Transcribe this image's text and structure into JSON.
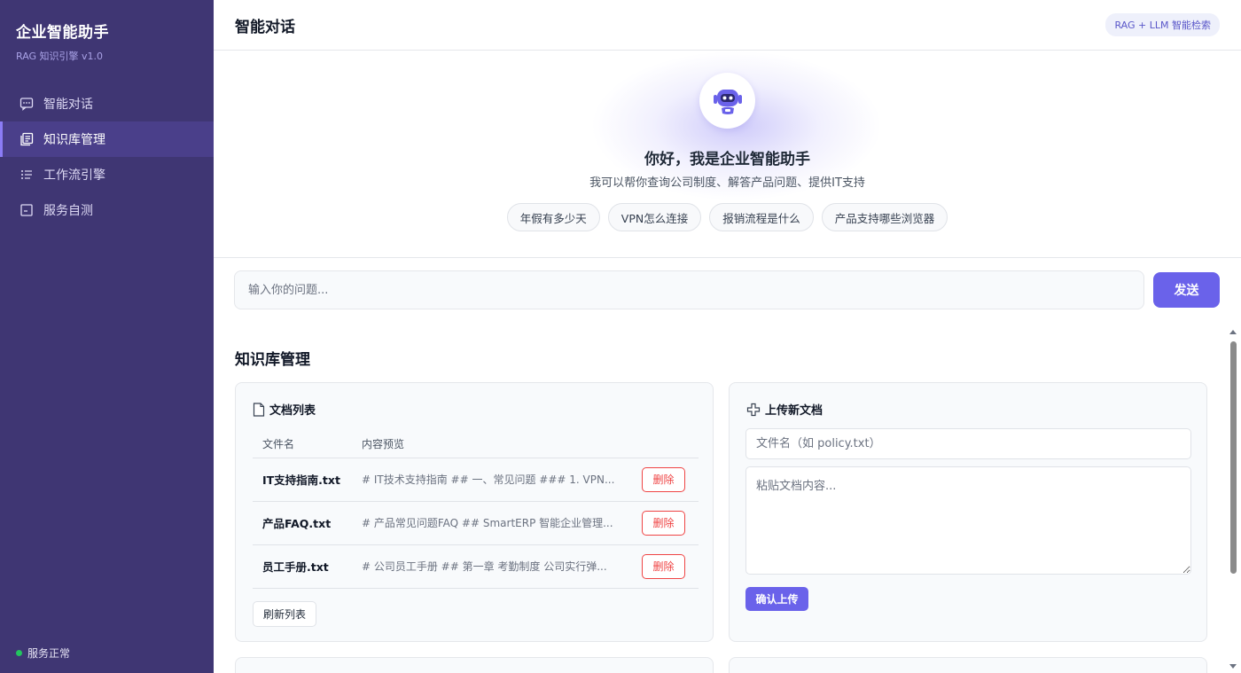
{
  "sidebar": {
    "brand_title": "企业智能助手",
    "brand_sub": "RAG 知识引擎 v1.0",
    "items": [
      {
        "label": "智能对话",
        "icon": "chat-icon",
        "active": false
      },
      {
        "label": "知识库管理",
        "icon": "library-icon",
        "active": true
      },
      {
        "label": "工作流引擎",
        "icon": "list-icon",
        "active": false
      },
      {
        "label": "服务自测",
        "icon": "checkbox-icon",
        "active": false
      }
    ],
    "status": "服务正常",
    "status_color": "#22c55e"
  },
  "topbar": {
    "title": "智能对话",
    "badge": "RAG + LLM 智能检索"
  },
  "welcome": {
    "title": "你好，我是企业智能助手",
    "subtitle": "我可以帮你查询公司制度、解答产品问题、提供IT支持",
    "suggestions": [
      "年假有多少天",
      "VPN怎么连接",
      "报销流程是什么",
      "产品支持哪些浏览器"
    ]
  },
  "chat_input": {
    "placeholder": "输入你的问题...",
    "send_label": "发送"
  },
  "knowledge": {
    "section_title": "知识库管理",
    "doc_list": {
      "title": "文档列表",
      "columns": [
        "文件名",
        "内容预览"
      ],
      "rows": [
        {
          "name": "IT支持指南.txt",
          "preview": "# IT技术支持指南 ## 一、常见问题 ### 1. VPN...",
          "delete_label": "删除"
        },
        {
          "name": "产品FAQ.txt",
          "preview": "# 产品常见问题FAQ ## SmartERP 智能企业管理...",
          "delete_label": "删除"
        },
        {
          "name": "员工手册.txt",
          "preview": "# 公司员工手册 ## 第一章 考勤制度 公司实行弹...",
          "delete_label": "删除"
        }
      ],
      "refresh_label": "刷新列表"
    },
    "upload": {
      "title": "上传新文档",
      "filename_placeholder": "文件名（如 policy.txt）",
      "content_placeholder": "粘贴文档内容...",
      "submit_label": "确认上传"
    }
  },
  "colors": {
    "sidebar_bg": "#3f3673",
    "accent": "#6a62ea",
    "danger": "#ef4444"
  }
}
